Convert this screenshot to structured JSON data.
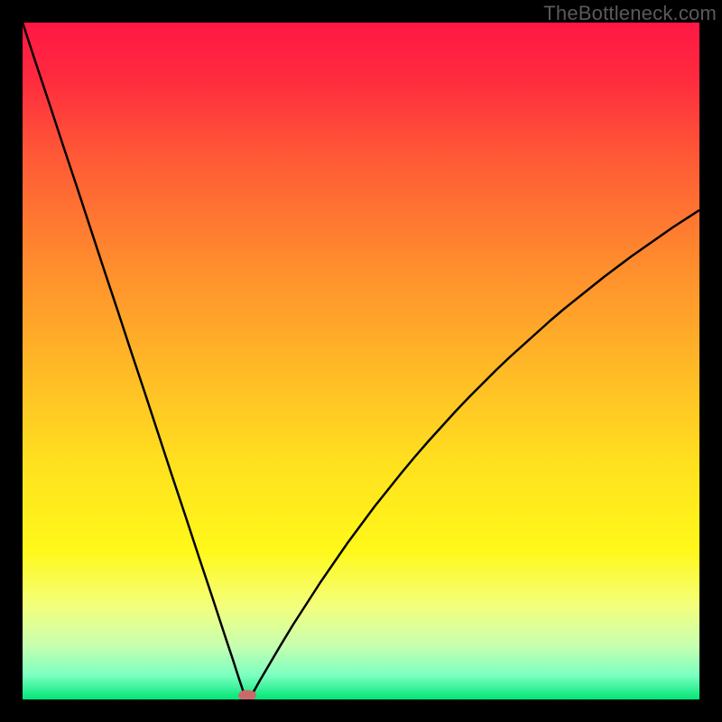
{
  "watermark": "TheBottleneck.com",
  "chart_data": {
    "type": "line",
    "title": "",
    "xlabel": "",
    "ylabel": "",
    "xlim": [
      0,
      100
    ],
    "ylim": [
      0,
      100
    ],
    "grid": false,
    "x": [
      0,
      2,
      4,
      6,
      8,
      10,
      12,
      14,
      16,
      18,
      20,
      22,
      24,
      26,
      28,
      30,
      31,
      32,
      33,
      33.5,
      34,
      35,
      36,
      38,
      40,
      42,
      44,
      46,
      48,
      50,
      52,
      54,
      56,
      58,
      60,
      62,
      64,
      66,
      68,
      70,
      72,
      74,
      76,
      78,
      80,
      82,
      84,
      86,
      88,
      90,
      92,
      94,
      96,
      98,
      100
    ],
    "values": [
      100.0,
      93.9,
      87.9,
      81.8,
      75.8,
      69.7,
      63.6,
      57.6,
      51.5,
      45.5,
      39.4,
      33.3,
      27.3,
      21.2,
      15.2,
      9.1,
      6.1,
      3.0,
      0.0,
      0.0,
      0.9,
      2.7,
      4.4,
      7.8,
      11.1,
      14.2,
      17.3,
      20.2,
      23.1,
      25.8,
      28.5,
      31.0,
      33.5,
      35.9,
      38.2,
      40.4,
      42.6,
      44.7,
      46.7,
      48.7,
      50.6,
      52.4,
      54.2,
      56.0,
      57.7,
      59.3,
      60.9,
      62.5,
      64.0,
      65.5,
      66.9,
      68.3,
      69.7,
      71.0,
      72.3
    ],
    "background_gradient": {
      "stops": [
        {
          "offset": 0.0,
          "color": "#ff1744"
        },
        {
          "offset": 0.08,
          "color": "#ff2a3f"
        },
        {
          "offset": 0.2,
          "color": "#ff5a36"
        },
        {
          "offset": 0.35,
          "color": "#ff8a2e"
        },
        {
          "offset": 0.5,
          "color": "#ffb627"
        },
        {
          "offset": 0.65,
          "color": "#ffe01f"
        },
        {
          "offset": 0.78,
          "color": "#fff81a"
        },
        {
          "offset": 0.86,
          "color": "#f4ff7a"
        },
        {
          "offset": 0.92,
          "color": "#c8ffb0"
        },
        {
          "offset": 0.965,
          "color": "#7affc0"
        },
        {
          "offset": 1.0,
          "color": "#00e676"
        }
      ]
    },
    "curve_color": "#000000",
    "marker": {
      "x": 33.2,
      "y": 0.6,
      "color": "#c96a6a",
      "rx": 10,
      "ry": 6
    }
  }
}
